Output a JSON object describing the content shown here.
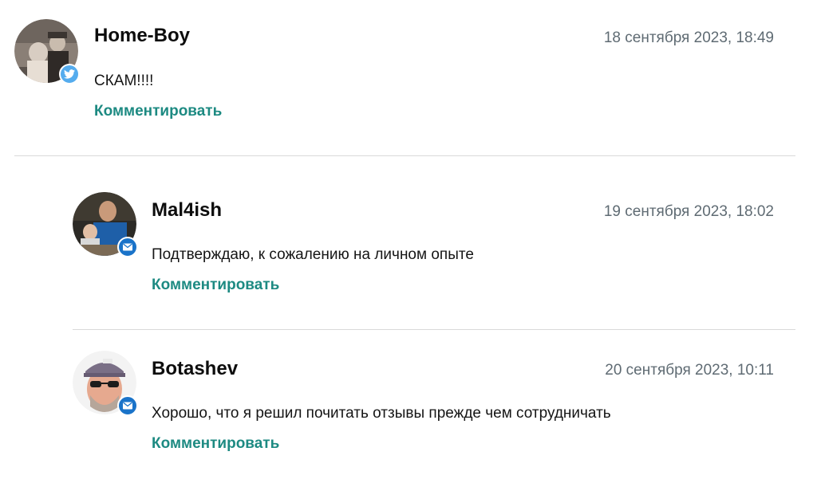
{
  "comments": [
    {
      "author": "Home-Boy",
      "date": "18 сентября 2023, 18:49",
      "text": "СКАМ!!!!",
      "reply_label": "Комментировать",
      "avatar_badge": "twitter-icon",
      "badge_color": "#55acee"
    },
    {
      "author": "Mal4ish",
      "date": "19 сентября 2023, 18:02",
      "text": "Подтверждаю, к сожалению на личном опыте",
      "reply_label": "Комментировать",
      "avatar_badge": "mail-icon",
      "badge_color": "#1a73c9"
    },
    {
      "author": "Botashev",
      "date": "20 сентября 2023, 10:11",
      "text": "Хорошо, что я решил почитать отзывы прежде чем сотрудничать",
      "reply_label": "Комментировать",
      "avatar_badge": "mail-icon",
      "badge_color": "#1a73c9"
    }
  ],
  "colors": {
    "accent": "#1d8a82",
    "date": "#5f6b73",
    "divider": "#d9d9d9"
  }
}
